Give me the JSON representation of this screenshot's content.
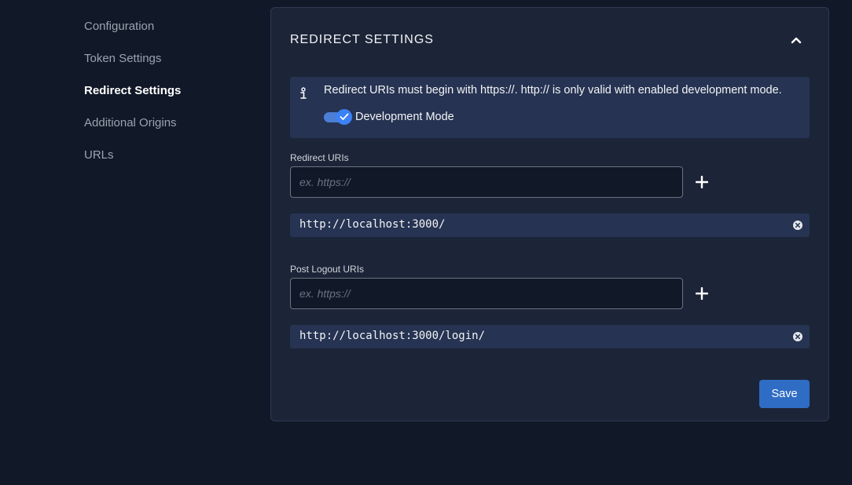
{
  "sidebar": {
    "items": [
      {
        "label": "Configuration"
      },
      {
        "label": "Token Settings"
      },
      {
        "label": "Redirect Settings"
      },
      {
        "label": "Additional Origins"
      },
      {
        "label": "URLs"
      }
    ],
    "active_index": 2
  },
  "card": {
    "title": "REDIRECT SETTINGS",
    "collapse_icon": "chevron-up-icon"
  },
  "info": {
    "icon": "info-icon",
    "text": "Redirect URIs must begin with https://. http:// is only valid with enabled development mode.",
    "toggle_label": "Development Mode",
    "toggle_on": true
  },
  "redirect": {
    "label": "Redirect URIs",
    "placeholder": "ex. https://",
    "value": "",
    "uris": [
      "http://localhost:3000/"
    ]
  },
  "post_logout": {
    "label": "Post Logout URIs",
    "placeholder": "ex. https://",
    "value": "",
    "uris": [
      "http://localhost:3000/login/"
    ]
  },
  "actions": {
    "save_label": "Save"
  },
  "colors": {
    "background": "#111827",
    "card": "#1c2538",
    "info_box": "#263352",
    "accent": "#2f6cc4"
  }
}
